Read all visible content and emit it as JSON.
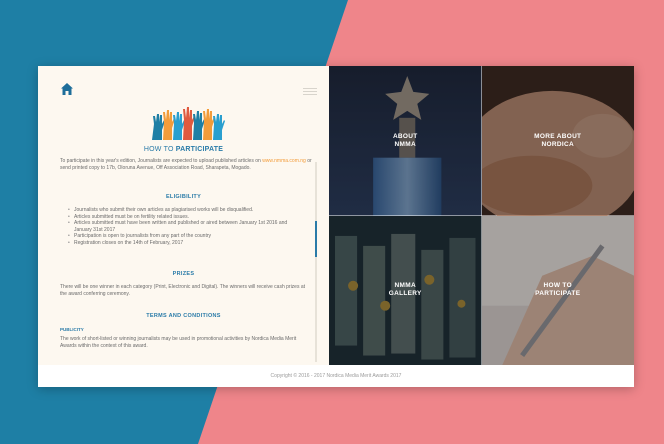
{
  "page": {
    "title_prefix": "HOW TO ",
    "title_bold": "PARTICIPATE",
    "intro_part1": "To participate in this year's edition, Journalists are expected to upload published articles on ",
    "intro_link": "www.nmma.com.ng",
    "intro_part2": " or send printed copy to 17b, Oloruna Avenue, Off Association Road, Sharapeta, Mogado.",
    "eligibility_heading": "ELIGIBILITY",
    "eligibility_items": [
      "Journalists who submit their own articles as plagiarised works will be disqualified.",
      "Articles submitted must be on fertility related issues.",
      "Articles submitted must have been written and published or aired between January 1st 2016 and January 31st 2017",
      "Participation is open to journalists from any part of the country",
      "Registration closes on the 14th of February, 2017"
    ],
    "prizes_heading": "PRIZES",
    "prizes_text": "There will be one winner in each category (Print, Electronic and Digital). The winners will receive cash prizes at the award conferring ceremony.",
    "terms_heading": "TERMS AND CONDITIONS",
    "publicity_subheading": "PUBLICITY",
    "publicity_text": "The work of short-listed or winning journalists may be used in promotional activities by Nordica Media Merit Awards within the context of this award."
  },
  "tiles": [
    {
      "label": "ABOUT\nNMMA"
    },
    {
      "label": "MORE ABOUT\nNORDICA"
    },
    {
      "label": "NMMA\nGALLERY"
    },
    {
      "label": "HOW TO\nPARTICIPATE"
    }
  ],
  "footer": {
    "copyright": "Copyright © 2016 - 2017 Nordica Media Merit Awards 2017"
  },
  "colors": {
    "blue": "#1e7fa5",
    "pink": "#ef858a",
    "accent": "#2a7ba8",
    "link": "#f39c3a"
  },
  "icons": [
    "home-icon",
    "hamburger-menu-icon",
    "raised-hands-icon"
  ]
}
